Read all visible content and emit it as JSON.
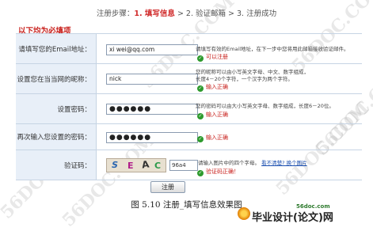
{
  "steps": {
    "prefix": "注册步骤：",
    "step1": "1. 填写信息",
    "sep1": " > ",
    "step2": "2. 验证邮箱",
    "sep2": " > ",
    "step3": "3. 注册成功"
  },
  "required_note": "以下均为必填项",
  "form": {
    "email": {
      "label": "请填写您的Email地址：",
      "value": "xi    wei@qq.com",
      "hint": "请填写有效的Email地址，在下一步中您将用此邮箱接收验证邮件。",
      "status": "可以注册"
    },
    "nickname": {
      "label": "设置您在当当网的昵称：",
      "value": "nick",
      "hint_lines": [
        "您的昵称可以由小写英文字母、中文、数字组成，",
        "长度4－20个字符，一个汉字为两个字符。"
      ],
      "status": "输入正确"
    },
    "password": {
      "label": "设置密码：",
      "value": "●●●●●●",
      "hint": "您的密码可以由大小写英文字母、数字组成，长度6－20位。",
      "status": "输入正确"
    },
    "confirm": {
      "label": "再次输入您设置的密码：",
      "value": "●●●●●●",
      "status": "输入正确"
    },
    "captcha": {
      "label": "验证码：",
      "image_chars": [
        "S",
        "E",
        "A",
        "C"
      ],
      "value": "96a4",
      "hint": "请输入图片中的四个字母。",
      "link": "看不清楚? 换个图片",
      "status": "验证码正确！"
    }
  },
  "submit_label": "注册",
  "caption": "图  5.10 注册_填写信息效果图",
  "watermarks": [
    "56DOC.COM",
    "56DOC.COM",
    "56DOC.COM",
    "56DOC.COM",
    "56DOC.COM",
    "56DOC.COM"
  ],
  "brand": {
    "site": "56doc.com",
    "name": "毕业设计(论文)网"
  }
}
